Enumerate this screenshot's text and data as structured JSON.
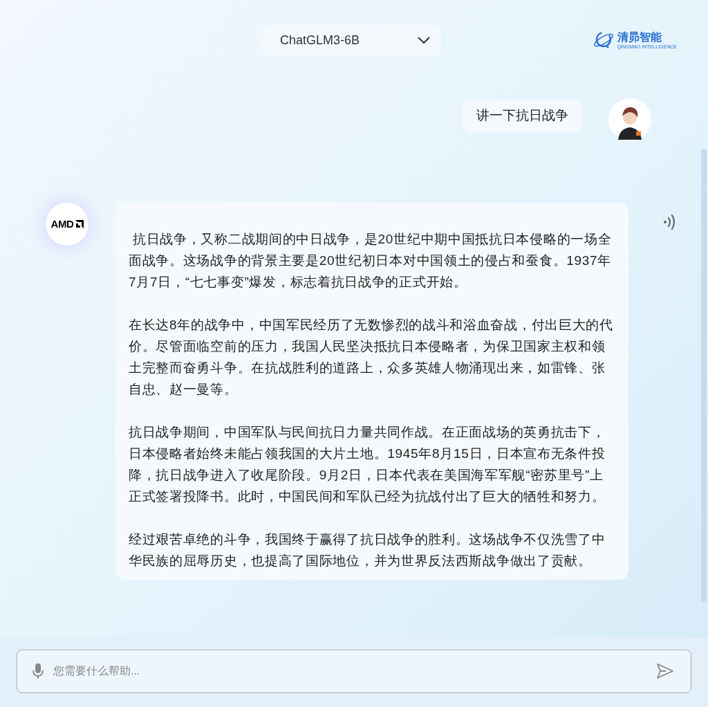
{
  "model_select": {
    "value": "ChatGLM3-6B"
  },
  "logo": {
    "name": "清昴智能",
    "tagline": "QINGMAO INTELLIGENCE"
  },
  "messages": [
    {
      "kind": "user",
      "paragraphs": [
        "讲一下抗日战争"
      ]
    },
    {
      "kind": "assistant",
      "avatar_text": "AMD",
      "paragraphs": [
        " 抗日战争，又称二战期间的中日战争，是20世纪中期中国抵抗日本侵略的一场全面战争。这场战争的背景主要是20世纪初日本对中国领土的侵占和蚕食。1937年7月7日，“七七事变”爆发，标志着抗日战争的正式开始。",
        "在长达8年的战争中，中国军民经历了无数惨烈的战斗和浴血奋战，付出巨大的代价。尽管面临空前的压力，我国人民坚决抵抗日本侵略者，为保卫国家主权和领土完整而奋勇斗争。在抗战胜利的道路上，众多英雄人物涌现出来，如雷锋、张自忠、赵一曼等。",
        "抗日战争期间，中国军队与民间抗日力量共同作战。在正面战场的英勇抗击下，日本侵略者始终未能占领我国的大片土地。1945年8月15日，日本宣布无条件投降，抗日战争进入了收尾阶段。9月2日，日本代表在美国海军军舰“密苏里号”上正式签署投降书。此时，中国民间和军队已经为抗战付出了巨大的牺牲和努力。",
        "经过艰苦卓绝的斗争，我国终于赢得了抗日战争的胜利。这场战争不仅洗雪了中华民族的屈辱历史，也提高了国际地位，并为世界反法西斯战争做出了贡献。"
      ]
    }
  ],
  "input": {
    "placeholder": "您需要什么帮助..."
  }
}
